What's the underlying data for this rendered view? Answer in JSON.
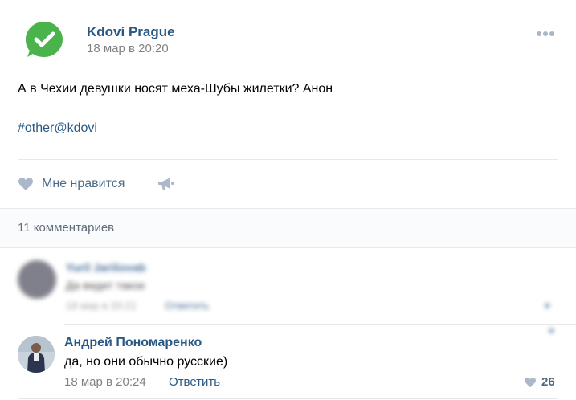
{
  "post": {
    "group_name": "Kdoví Prague",
    "time": "18 мар в 20:20",
    "text": "А в Чехии девушки носят меха-Шубы жилетки? Анон",
    "hashtag": "#other@kdovi",
    "logo_icon": "check-speech-bubble-icon",
    "logo_color": "#4bb34b"
  },
  "actions": {
    "like_label": "Мне нравится",
    "like_icon": "heart-icon",
    "share_icon": "megaphone-icon"
  },
  "comments": {
    "count_label": "11 комментариев",
    "blurred": {
      "name": "Yuriĭ Jarišovab",
      "text": "Да видит такое",
      "time": "18 мар в 20:21",
      "reply": "Ответить"
    },
    "items": [
      {
        "author": "Андрей Пономаренко",
        "text": "да, но они обычно русские)",
        "time": "18 мар в 20:24",
        "reply_label": "Ответить",
        "likes": "26"
      }
    ]
  },
  "colors": {
    "link": "#2a5885",
    "meta": "#828282",
    "like_icon": "#aab8c9"
  }
}
